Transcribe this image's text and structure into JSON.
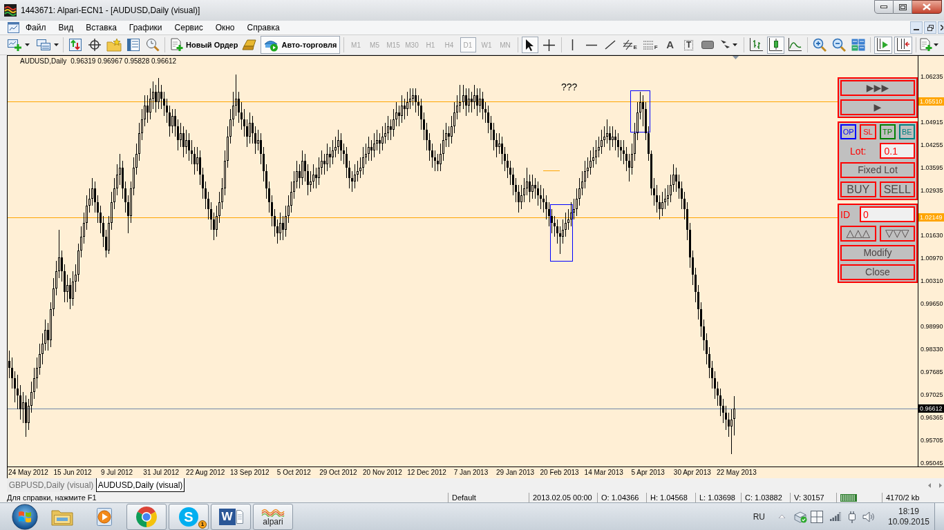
{
  "window": {
    "title": "1443671: Alpari-ECN1 - [AUDUSD,Daily (visual)]"
  },
  "menu": [
    "Файл",
    "Вид",
    "Вставка",
    "Графики",
    "Сервис",
    "Окно",
    "Справка"
  ],
  "toolbar": {
    "new_order_button": "Новый Ордер",
    "autotrading_button": {
      "label": "Авто-торговля",
      "on": true
    },
    "periods": [
      {
        "label": "M1",
        "selected": false,
        "disabled": true
      },
      {
        "label": "M5",
        "selected": false,
        "disabled": true
      },
      {
        "label": "M15",
        "selected": false,
        "disabled": true
      },
      {
        "label": "M30",
        "selected": false,
        "disabled": true
      },
      {
        "label": "H1",
        "selected": false,
        "disabled": true
      },
      {
        "label": "H4",
        "selected": false,
        "disabled": true
      },
      {
        "label": "D1",
        "selected": true,
        "disabled": true
      },
      {
        "label": "W1",
        "selected": false,
        "disabled": true
      },
      {
        "label": "MN",
        "selected": false,
        "disabled": true
      }
    ],
    "pointer_tools": [
      {
        "kind": "cursor",
        "selected": true
      },
      {
        "kind": "crosshair",
        "selected": false
      }
    ],
    "drawing_tools": [
      {
        "kind": "vline",
        "selected": false
      },
      {
        "kind": "hline",
        "selected": false
      },
      {
        "kind": "trendline",
        "selected": false
      },
      {
        "kind": "channel",
        "glyph": "E",
        "selected": false
      },
      {
        "kind": "fibo",
        "glyph": "F",
        "selected": false
      },
      {
        "kind": "text",
        "glyph": "A",
        "selected": false
      },
      {
        "kind": "label",
        "glyph": "T",
        "selected": false
      },
      {
        "kind": "shape",
        "selected": false
      },
      {
        "kind": "arrows",
        "selected": false
      }
    ],
    "chart_types": [
      {
        "kind": "bars",
        "selected": false
      },
      {
        "kind": "candles",
        "selected": true
      },
      {
        "kind": "line",
        "selected": false
      }
    ],
    "chart_toggles": [
      {
        "kind": "autoscroll",
        "on": true
      },
      {
        "kind": "shift",
        "on": true
      }
    ]
  },
  "chart": {
    "chart_data": [
      {
        "type": "candlestick",
        "title": "AUDUSD,Daily",
        "subtitle": "0.96319 0.96967 0.95828 0.96612",
        "categories": [
          null,
          null,
          null,
          null,
          null,
          null,
          null,
          "24 May 2012",
          null,
          null,
          null,
          null,
          null,
          null,
          null,
          null,
          null,
          null,
          null,
          null,
          null,
          null,
          null,
          "15 Jun 2012",
          null,
          null,
          null,
          null,
          null,
          null,
          null,
          null,
          null,
          null,
          null,
          null,
          null,
          null,
          null,
          "9 Jul 2012",
          null,
          null,
          null,
          null,
          null,
          null,
          null,
          null,
          null,
          null,
          null,
          null,
          null,
          null,
          null,
          "31 Jul 2012",
          null,
          null,
          null,
          null,
          null,
          null,
          null,
          null,
          null,
          null,
          null,
          null,
          null,
          null,
          null,
          "22 Aug 2012",
          null,
          null,
          null,
          null,
          null,
          null,
          null,
          null,
          null,
          null,
          null,
          null,
          null,
          null,
          null,
          "13 Sep 2012",
          null,
          null,
          null,
          null,
          null,
          null,
          null,
          null,
          null,
          null,
          null,
          null,
          null,
          null,
          null,
          "5 Oct 2012",
          null,
          null,
          null,
          null,
          null,
          null,
          null,
          null,
          null,
          null,
          null,
          null,
          null,
          null,
          null,
          "29 Oct 2012",
          null,
          null,
          null,
          null,
          null,
          null,
          null,
          null,
          null,
          null,
          null,
          null,
          null,
          null,
          null,
          "20 Nov 2012",
          null,
          null,
          null,
          null,
          null,
          null,
          null,
          null,
          null,
          null,
          null,
          null,
          null,
          null,
          null,
          "12 Dec 2012",
          null,
          null,
          null,
          null,
          null,
          null,
          null,
          null,
          null,
          null,
          null,
          null,
          null,
          null,
          null,
          "7 Jan 2013",
          null,
          null,
          null,
          null,
          null,
          null,
          null,
          null,
          null,
          null,
          null,
          null,
          null,
          null,
          null,
          "29 Jan 2013",
          null,
          null,
          null,
          null,
          null,
          null,
          null,
          null,
          null,
          null,
          null,
          null,
          null,
          null,
          null,
          "20 Feb 2013",
          null,
          null,
          null,
          null,
          null,
          null,
          null,
          null,
          null,
          null,
          null,
          null,
          null,
          null,
          null,
          "14 Mar 2013",
          null,
          null,
          null,
          null,
          null,
          null,
          null,
          null,
          null,
          null,
          null,
          null,
          null,
          null,
          null,
          "5 Apr 2013",
          null,
          null,
          null,
          null,
          null,
          null,
          null,
          null,
          null,
          null,
          null,
          null,
          null,
          null,
          null,
          "30 Apr 2013",
          null,
          null,
          null,
          null,
          null,
          null,
          null,
          null,
          null,
          null,
          null,
          null,
          null,
          null,
          null,
          "22 May 2013",
          null,
          null,
          null,
          null,
          null,
          null,
          null,
          null,
          null,
          null,
          null,
          null,
          null,
          null,
          null,
          null,
          null,
          null,
          null,
          null,
          null,
          null,
          null,
          null,
          null,
          null,
          null,
          null,
          null,
          null,
          null,
          null,
          null,
          null,
          null,
          null,
          null,
          null,
          null,
          null,
          null,
          null,
          null,
          null,
          null,
          null,
          null,
          null,
          null,
          null,
          null,
          null,
          null,
          null,
          null,
          null,
          null,
          null,
          null,
          null,
          null,
          null,
          null,
          null,
          null
        ],
        "ohlc": [
          [
            0.98,
            0.983,
            0.975,
            0.978
          ],
          [
            0.978,
            0.981,
            0.972,
            0.975
          ],
          [
            0.975,
            0.977,
            0.968,
            0.972
          ],
          [
            0.972,
            0.976,
            0.966,
            0.97
          ],
          [
            0.97,
            0.973,
            0.963,
            0.966
          ],
          [
            0.966,
            0.971,
            0.962,
            0.968
          ],
          [
            0.968,
            0.97,
            0.958,
            0.962
          ],
          [
            0.962,
            0.969,
            0.96,
            0.967
          ],
          [
            0.967,
            0.974,
            0.965,
            0.971
          ],
          [
            0.971,
            0.978,
            0.969,
            0.975
          ],
          [
            0.975,
            0.981,
            0.972,
            0.978
          ],
          [
            0.978,
            0.985,
            0.976,
            0.982
          ],
          [
            0.982,
            0.988,
            0.979,
            0.985
          ],
          [
            0.985,
            0.992,
            0.983,
            0.989
          ],
          [
            0.989,
            0.991,
            0.983,
            0.986
          ],
          [
            0.986,
            0.997,
            0.984,
            0.995
          ],
          [
            0.995,
            1.004,
            0.993,
            1.001
          ],
          [
            1.001,
            1.009,
            0.999,
            1.006
          ],
          [
            1.006,
            1.018,
            1.004,
            1.01
          ],
          [
            1.01,
            1.012,
            1.003,
            1.006
          ],
          [
            1.006,
            1.008,
            0.997,
            1.0
          ],
          [
            1.0,
            1.005,
            0.997,
            1.002
          ],
          [
            1.002,
            1.004,
            0.995,
            0.998
          ],
          [
            0.998,
            1.006,
            0.996,
            1.003
          ],
          [
            1.003,
            1.008,
            1.0,
            1.005
          ],
          [
            1.005,
            1.014,
            1.003,
            1.012
          ],
          [
            1.012,
            1.019,
            1.01,
            1.016
          ],
          [
            1.016,
            1.023,
            1.014,
            1.02
          ],
          [
            1.02,
            1.028,
            1.018,
            1.025
          ],
          [
            1.025,
            1.03,
            1.023,
            1.027
          ],
          [
            1.027,
            1.033,
            1.025,
            1.03
          ],
          [
            1.03,
            1.032,
            1.023,
            1.026
          ],
          [
            1.026,
            1.028,
            1.02,
            1.023
          ],
          [
            1.023,
            1.025,
            1.017,
            1.02
          ],
          [
            1.02,
            1.022,
            1.013,
            1.016
          ],
          [
            1.016,
            1.018,
            1.01,
            1.012
          ],
          [
            1.012,
            1.022,
            1.011,
            1.02
          ],
          [
            1.02,
            1.029,
            1.018,
            1.026
          ],
          [
            1.026,
            1.033,
            1.024,
            1.03
          ],
          [
            1.03,
            1.037,
            1.028,
            1.034
          ],
          [
            1.034,
            1.04,
            1.031,
            1.036
          ],
          [
            1.036,
            1.038,
            1.027,
            1.03
          ],
          [
            1.03,
            1.032,
            1.023,
            1.026
          ],
          [
            1.026,
            1.028,
            1.017,
            1.022
          ],
          [
            1.022,
            1.032,
            1.02,
            1.03
          ],
          [
            1.03,
            1.039,
            1.028,
            1.036
          ],
          [
            1.036,
            1.043,
            1.034,
            1.04
          ],
          [
            1.04,
            1.049,
            1.038,
            1.046
          ],
          [
            1.046,
            1.053,
            1.044,
            1.05
          ],
          [
            1.05,
            1.057,
            1.048,
            1.054
          ],
          [
            1.054,
            1.057,
            1.049,
            1.052
          ],
          [
            1.052,
            1.059,
            1.05,
            1.056
          ],
          [
            1.056,
            1.061,
            1.053,
            1.058
          ],
          [
            1.058,
            1.06,
            1.052,
            1.055
          ],
          [
            1.055,
            1.062,
            1.053,
            1.058
          ],
          [
            1.058,
            1.06,
            1.053,
            1.056
          ],
          [
            1.056,
            1.058,
            1.051,
            1.054
          ],
          [
            1.054,
            1.056,
            1.049,
            1.052
          ],
          [
            1.052,
            1.054,
            1.045,
            1.048
          ],
          [
            1.048,
            1.053,
            1.046,
            1.051
          ],
          [
            1.051,
            1.053,
            1.045,
            1.048
          ],
          [
            1.048,
            1.05,
            1.041,
            1.044
          ],
          [
            1.044,
            1.049,
            1.042,
            1.046
          ],
          [
            1.046,
            1.048,
            1.039,
            1.042
          ],
          [
            1.042,
            1.047,
            1.04,
            1.044
          ],
          [
            1.044,
            1.046,
            1.038,
            1.041
          ],
          [
            1.041,
            1.044,
            1.037,
            1.04
          ],
          [
            1.04,
            1.042,
            1.034,
            1.037
          ],
          [
            1.037,
            1.042,
            1.035,
            1.039
          ],
          [
            1.039,
            1.041,
            1.031,
            1.034
          ],
          [
            1.034,
            1.036,
            1.027,
            1.03
          ],
          [
            1.03,
            1.032,
            1.024,
            1.027
          ],
          [
            1.027,
            1.029,
            1.021,
            1.024
          ],
          [
            1.024,
            1.026,
            1.018,
            1.021
          ],
          [
            1.021,
            1.023,
            1.015,
            1.018
          ],
          [
            1.018,
            1.025,
            1.016,
            1.022
          ],
          [
            1.022,
            1.029,
            1.02,
            1.026
          ],
          [
            1.026,
            1.033,
            1.024,
            1.03
          ],
          [
            1.03,
            1.041,
            1.028,
            1.038
          ],
          [
            1.038,
            1.048,
            1.036,
            1.045
          ],
          [
            1.045,
            1.053,
            1.043,
            1.05
          ],
          [
            1.05,
            1.058,
            1.048,
            1.054
          ],
          [
            1.054,
            1.063,
            1.051,
            1.056
          ],
          [
            1.056,
            1.058,
            1.049,
            1.052
          ],
          [
            1.052,
            1.055,
            1.047,
            1.05
          ],
          [
            1.05,
            1.053,
            1.045,
            1.048
          ],
          [
            1.048,
            1.05,
            1.042,
            1.045
          ],
          [
            1.045,
            1.052,
            1.043,
            1.049
          ],
          [
            1.049,
            1.051,
            1.043,
            1.046
          ],
          [
            1.046,
            1.048,
            1.04,
            1.043
          ],
          [
            1.043,
            1.047,
            1.041,
            1.044
          ],
          [
            1.044,
            1.046,
            1.037,
            1.04
          ],
          [
            1.04,
            1.042,
            1.032,
            1.035
          ],
          [
            1.035,
            1.037,
            1.027,
            1.03
          ],
          [
            1.03,
            1.032,
            1.023,
            1.026
          ],
          [
            1.026,
            1.028,
            1.019,
            1.022
          ],
          [
            1.022,
            1.024,
            1.016,
            1.019
          ],
          [
            1.019,
            1.021,
            1.014,
            1.017
          ],
          [
            1.017,
            1.023,
            1.015,
            1.02
          ],
          [
            1.02,
            1.022,
            1.015,
            1.018
          ],
          [
            1.018,
            1.025,
            1.016,
            1.022
          ],
          [
            1.022,
            1.028,
            1.02,
            1.025
          ],
          [
            1.025,
            1.032,
            1.023,
            1.029
          ],
          [
            1.029,
            1.035,
            1.027,
            1.032
          ],
          [
            1.032,
            1.038,
            1.03,
            1.035
          ],
          [
            1.035,
            1.037,
            1.03,
            1.033
          ],
          [
            1.033,
            1.041,
            1.031,
            1.038
          ],
          [
            1.038,
            1.04,
            1.032,
            1.035
          ],
          [
            1.035,
            1.037,
            1.028,
            1.031
          ],
          [
            1.031,
            1.035,
            1.029,
            1.032
          ],
          [
            1.032,
            1.037,
            1.03,
            1.034
          ],
          [
            1.034,
            1.036,
            1.03,
            1.033
          ],
          [
            1.033,
            1.039,
            1.031,
            1.036
          ],
          [
            1.036,
            1.041,
            1.034,
            1.038
          ],
          [
            1.038,
            1.04,
            1.034,
            1.037
          ],
          [
            1.037,
            1.043,
            1.035,
            1.04
          ],
          [
            1.04,
            1.042,
            1.036,
            1.039
          ],
          [
            1.039,
            1.044,
            1.037,
            1.041
          ],
          [
            1.041,
            1.045,
            1.039,
            1.042
          ],
          [
            1.042,
            1.047,
            1.04,
            1.044
          ],
          [
            1.044,
            1.046,
            1.038,
            1.041
          ],
          [
            1.041,
            1.043,
            1.037,
            1.04
          ],
          [
            1.04,
            1.042,
            1.033,
            1.036
          ],
          [
            1.036,
            1.038,
            1.03,
            1.033
          ],
          [
            1.033,
            1.035,
            1.029,
            1.032
          ],
          [
            1.032,
            1.037,
            1.03,
            1.034
          ],
          [
            1.034,
            1.038,
            1.032,
            1.035
          ],
          [
            1.035,
            1.039,
            1.033,
            1.036
          ],
          [
            1.036,
            1.042,
            1.034,
            1.039
          ],
          [
            1.039,
            1.043,
            1.037,
            1.04
          ],
          [
            1.04,
            1.045,
            1.038,
            1.042
          ],
          [
            1.042,
            1.044,
            1.038,
            1.041
          ],
          [
            1.041,
            1.046,
            1.039,
            1.043
          ],
          [
            1.043,
            1.047,
            1.041,
            1.044
          ],
          [
            1.044,
            1.046,
            1.04,
            1.043
          ],
          [
            1.043,
            1.048,
            1.041,
            1.045
          ],
          [
            1.045,
            1.049,
            1.043,
            1.046
          ],
          [
            1.046,
            1.051,
            1.044,
            1.048
          ],
          [
            1.048,
            1.05,
            1.044,
            1.047
          ],
          [
            1.047,
            1.053,
            1.045,
            1.05
          ],
          [
            1.05,
            1.055,
            1.048,
            1.052
          ],
          [
            1.052,
            1.054,
            1.048,
            1.051
          ],
          [
            1.051,
            1.057,
            1.049,
            1.054
          ],
          [
            1.054,
            1.056,
            1.05,
            1.053
          ],
          [
            1.053,
            1.058,
            1.051,
            1.055
          ],
          [
            1.055,
            1.059,
            1.053,
            1.056
          ],
          [
            1.056,
            1.059,
            1.054,
            1.057
          ],
          [
            1.057,
            1.059,
            1.052,
            1.055
          ],
          [
            1.055,
            1.057,
            1.051,
            1.054
          ],
          [
            1.054,
            1.056,
            1.047,
            1.05
          ],
          [
            1.05,
            1.052,
            1.044,
            1.047
          ],
          [
            1.047,
            1.049,
            1.041,
            1.044
          ],
          [
            1.044,
            1.046,
            1.038,
            1.041
          ],
          [
            1.041,
            1.043,
            1.036,
            1.039
          ],
          [
            1.039,
            1.041,
            1.035,
            1.038
          ],
          [
            1.038,
            1.04,
            1.035,
            1.037
          ],
          [
            1.037,
            1.043,
            1.035,
            1.04
          ],
          [
            1.04,
            1.047,
            1.038,
            1.044
          ],
          [
            1.044,
            1.049,
            1.042,
            1.046
          ],
          [
            1.046,
            1.048,
            1.042,
            1.045
          ],
          [
            1.045,
            1.051,
            1.043,
            1.048
          ],
          [
            1.048,
            1.055,
            1.046,
            1.052
          ],
          [
            1.052,
            1.057,
            1.05,
            1.054
          ],
          [
            1.054,
            1.06,
            1.052,
            1.055
          ],
          [
            1.055,
            1.06,
            1.053,
            1.057
          ],
          [
            1.057,
            1.059,
            1.051,
            1.054
          ],
          [
            1.054,
            1.059,
            1.052,
            1.056
          ],
          [
            1.056,
            1.058,
            1.052,
            1.055
          ],
          [
            1.055,
            1.06,
            1.053,
            1.057
          ],
          [
            1.057,
            1.059,
            1.051,
            1.054
          ],
          [
            1.054,
            1.059,
            1.052,
            1.056
          ],
          [
            1.056,
            1.058,
            1.05,
            1.053
          ],
          [
            1.053,
            1.055,
            1.049,
            1.052
          ],
          [
            1.052,
            1.054,
            1.046,
            1.049
          ],
          [
            1.049,
            1.051,
            1.044,
            1.047
          ],
          [
            1.047,
            1.049,
            1.041,
            1.044
          ],
          [
            1.044,
            1.046,
            1.039,
            1.042
          ],
          [
            1.042,
            1.046,
            1.04,
            1.043
          ],
          [
            1.043,
            1.045,
            1.037,
            1.04
          ],
          [
            1.04,
            1.042,
            1.035,
            1.038
          ],
          [
            1.038,
            1.04,
            1.033,
            1.036
          ],
          [
            1.036,
            1.038,
            1.031,
            1.034
          ],
          [
            1.034,
            1.036,
            1.028,
            1.031
          ],
          [
            1.031,
            1.033,
            1.026,
            1.029
          ],
          [
            1.029,
            1.031,
            1.023,
            1.026
          ],
          [
            1.026,
            1.031,
            1.024,
            1.028
          ],
          [
            1.028,
            1.033,
            1.026,
            1.03
          ],
          [
            1.03,
            1.036,
            1.028,
            1.032
          ],
          [
            1.032,
            1.034,
            1.026,
            1.029
          ],
          [
            1.029,
            1.034,
            1.027,
            1.031
          ],
          [
            1.031,
            1.033,
            1.027,
            1.03
          ],
          [
            1.03,
            1.032,
            1.025,
            1.028
          ],
          [
            1.028,
            1.031,
            1.024,
            1.027
          ],
          [
            1.027,
            1.03,
            1.023,
            1.026
          ],
          [
            1.026,
            1.028,
            1.021,
            1.024
          ],
          [
            1.024,
            1.026,
            1.019,
            1.022
          ],
          [
            1.022,
            1.024,
            1.017,
            1.02
          ],
          [
            1.02,
            1.022,
            1.016,
            1.019
          ],
          [
            1.019,
            1.021,
            1.014,
            1.017
          ],
          [
            1.017,
            1.019,
            1.011,
            1.016
          ],
          [
            1.016,
            1.021,
            1.014,
            1.018
          ],
          [
            1.018,
            1.023,
            1.016,
            1.02
          ],
          [
            1.02,
            1.024,
            1.018,
            1.021
          ],
          [
            1.021,
            1.026,
            1.019,
            1.023
          ],
          [
            1.023,
            1.027,
            1.021,
            1.024
          ],
          [
            1.024,
            1.03,
            1.022,
            1.027
          ],
          [
            1.027,
            1.033,
            1.025,
            1.03
          ],
          [
            1.03,
            1.035,
            1.028,
            1.032
          ],
          [
            1.032,
            1.038,
            1.03,
            1.035
          ],
          [
            1.035,
            1.039,
            1.033,
            1.036
          ],
          [
            1.036,
            1.041,
            1.034,
            1.038
          ],
          [
            1.038,
            1.042,
            1.036,
            1.039
          ],
          [
            1.039,
            1.044,
            1.037,
            1.041
          ],
          [
            1.041,
            1.045,
            1.039,
            1.042
          ],
          [
            1.042,
            1.047,
            1.04,
            1.044
          ],
          [
            1.044,
            1.048,
            1.042,
            1.045
          ],
          [
            1.045,
            1.05,
            1.043,
            1.046
          ],
          [
            1.046,
            1.048,
            1.041,
            1.044
          ],
          [
            1.044,
            1.048,
            1.042,
            1.045
          ],
          [
            1.045,
            1.047,
            1.041,
            1.044
          ],
          [
            1.044,
            1.046,
            1.039,
            1.042
          ],
          [
            1.042,
            1.044,
            1.038,
            1.041
          ],
          [
            1.041,
            1.044,
            1.037,
            1.04
          ],
          [
            1.04,
            1.042,
            1.035,
            1.038
          ],
          [
            1.038,
            1.04,
            1.032,
            1.036
          ],
          [
            1.036,
            1.043,
            1.034,
            1.04
          ],
          [
            1.04,
            1.049,
            1.038,
            1.046
          ],
          [
            1.046,
            1.055,
            1.044,
            1.052
          ],
          [
            1.052,
            1.058,
            1.05,
            1.055
          ],
          [
            1.055,
            1.057,
            1.048,
            1.053
          ],
          [
            1.053,
            1.055,
            1.044,
            1.046
          ],
          [
            1.046,
            1.048,
            1.038,
            1.04
          ],
          [
            1.04,
            1.041,
            1.028,
            1.03
          ],
          [
            1.03,
            1.033,
            1.025,
            1.028
          ],
          [
            1.028,
            1.031,
            1.023,
            1.026
          ],
          [
            1.026,
            1.028,
            1.021,
            1.024
          ],
          [
            1.024,
            1.029,
            1.022,
            1.026
          ],
          [
            1.026,
            1.03,
            1.024,
            1.027
          ],
          [
            1.027,
            1.031,
            1.025,
            1.028
          ],
          [
            1.028,
            1.034,
            1.026,
            1.031
          ],
          [
            1.031,
            1.037,
            1.029,
            1.034
          ],
          [
            1.034,
            1.036,
            1.029,
            1.032
          ],
          [
            1.032,
            1.034,
            1.027,
            1.03
          ],
          [
            1.03,
            1.032,
            1.024,
            1.027
          ],
          [
            1.027,
            1.029,
            1.021,
            1.024
          ],
          [
            1.024,
            1.026,
            1.015,
            1.018
          ],
          [
            1.018,
            1.02,
            1.007,
            1.01
          ],
          [
            1.01,
            1.012,
            1.002,
            1.005
          ],
          [
            1.005,
            1.007,
            0.997,
            1.0
          ],
          [
            1.0,
            1.002,
            0.992,
            0.995
          ],
          [
            0.995,
            0.997,
            0.987,
            0.99
          ],
          [
            0.99,
            0.992,
            0.983,
            0.986
          ],
          [
            0.986,
            0.988,
            0.979,
            0.982
          ],
          [
            0.982,
            0.984,
            0.975,
            0.978
          ],
          [
            0.978,
            0.98,
            0.972,
            0.975
          ],
          [
            0.975,
            0.977,
            0.969,
            0.972
          ],
          [
            0.972,
            0.974,
            0.967,
            0.97
          ],
          [
            0.97,
            0.972,
            0.964,
            0.967
          ],
          [
            0.967,
            0.969,
            0.962,
            0.965
          ],
          [
            0.965,
            0.967,
            0.96,
            0.963
          ],
          [
            0.963,
            0.965,
            0.958,
            0.961
          ],
          [
            0.961,
            0.966,
            0.953,
            0.963
          ],
          [
            0.96319,
            0.96967,
            0.95828,
            0.96612
          ],
          null,
          null,
          null,
          null,
          null,
          null,
          null,
          null,
          null,
          null,
          null,
          null,
          null,
          null,
          null,
          null,
          null,
          null,
          null,
          null,
          null,
          null,
          null,
          null,
          null,
          null,
          null,
          null,
          null,
          null,
          null,
          null,
          null,
          null,
          null,
          null,
          null,
          null,
          null,
          null,
          null,
          null,
          null,
          null,
          null,
          null,
          null,
          null,
          null,
          null,
          null,
          null,
          null,
          null,
          null,
          null,
          null,
          null,
          null,
          null,
          null,
          null,
          null,
          null,
          null,
          null
        ],
        "ylim": [
          0.94935,
          1.06835
        ],
        "yticks": [
          {
            "value": 1.06235,
            "label": "1.06235"
          },
          {
            "value": 1.04915,
            "label": "1.04915"
          },
          {
            "value": 1.04255,
            "label": "1.04255"
          },
          {
            "value": 1.03595,
            "label": "1.03595"
          },
          {
            "value": 1.02935,
            "label": "1.02935"
          },
          {
            "value": 1.0163,
            "label": "1.01630"
          },
          {
            "value": 1.0097,
            "label": "1.00970"
          },
          {
            "value": 1.0031,
            "label": "1.00310"
          },
          {
            "value": 0.9965,
            "label": "0.99650"
          },
          {
            "value": 0.9899,
            "label": "0.98990"
          },
          {
            "value": 0.9833,
            "label": "0.98330"
          },
          {
            "value": 0.97685,
            "label": "0.97685"
          },
          {
            "value": 0.97025,
            "label": "0.97025"
          },
          {
            "value": 0.96365,
            "label": "0.96365"
          },
          {
            "value": 0.95705,
            "label": "0.95705"
          },
          {
            "value": 0.95045,
            "label": "0.95045"
          }
        ],
        "ref_lines": [
          {
            "axis": "y",
            "value": 1.0551,
            "label": "1.05510",
            "color": "#ffa500"
          },
          {
            "axis": "y",
            "value": 1.02149,
            "label": "1.02149",
            "color": "#ffa500"
          },
          {
            "axis": "y",
            "value": 0.96612,
            "label": "0.96612",
            "color": "#7088a8"
          }
        ],
        "annotations": [
          "???"
        ]
      }
    ]
  },
  "trade_panel": {
    "step_buttons": [
      "▶▶▶",
      "▶"
    ],
    "mode_buttons": [
      {
        "label": "OP",
        "color": "#0000ff"
      },
      {
        "label": "SL",
        "color": "#ff0000"
      },
      {
        "label": "TP",
        "color": "#008000"
      },
      {
        "label": "BE",
        "color": "#008080"
      }
    ],
    "lot": {
      "label": "Lot:",
      "value": "0.1"
    },
    "fixed_lot_button": "Fixed Lot",
    "buy_button": "BUY",
    "sell_button": "SELL",
    "ticket": {
      "label": "ID",
      "value": "0"
    },
    "move_buttons": [
      "△△△",
      "▽▽▽"
    ],
    "modify_button": "Modify",
    "close_button": "Close"
  },
  "tabs": [
    {
      "label": "GBPUSD,Daily (visual)",
      "selected": false
    },
    {
      "label": "AUDUSD,Daily (visual)",
      "selected": true
    }
  ],
  "status_bar": {
    "help": "Для справки, нажмите F1",
    "fields": [
      "Default",
      "2013.02.05 00:00",
      "O: 1.04366",
      "H: 1.04568",
      "L: 1.03698",
      "C: 1.03882",
      "V: 30157"
    ],
    "connection": "4170/2 kb"
  },
  "taskbar": {
    "apps": [
      {
        "kind": "folder",
        "running": false
      },
      {
        "kind": "media",
        "running": false
      },
      {
        "kind": "browser",
        "running": true
      },
      {
        "kind": "chat",
        "glyph": "S",
        "badge": "1",
        "running": true
      },
      {
        "kind": "document",
        "glyph": "W",
        "running": true
      },
      {
        "kind": "trading",
        "label": "alpari",
        "running": true
      }
    ],
    "language": "RU",
    "time": "18:19",
    "date": "10.09.2015"
  }
}
